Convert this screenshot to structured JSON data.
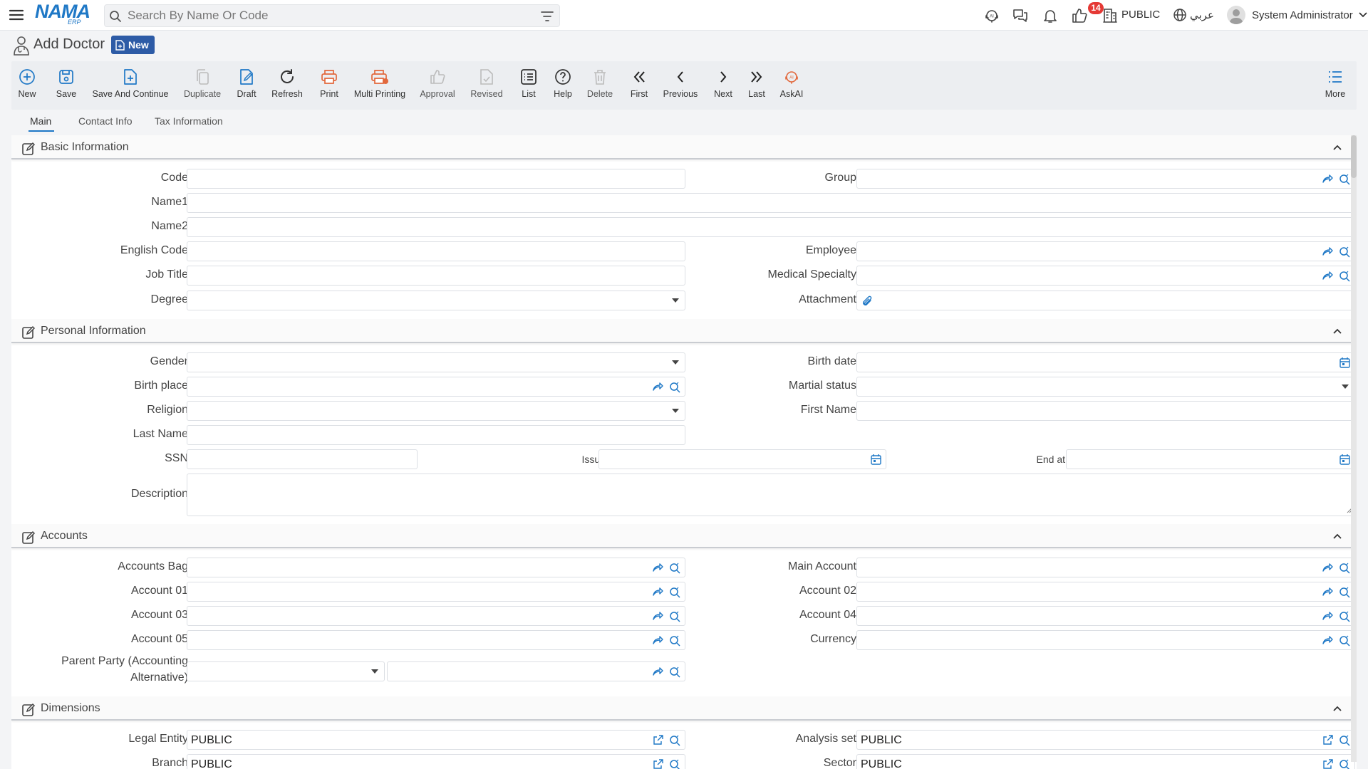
{
  "topbar": {
    "search_placeholder": "Search By Name Or Code",
    "notification_count": "14",
    "company": "PUBLIC",
    "language": "عربي",
    "user": "System Administrator",
    "logo_main": "NAMA",
    "logo_sub": "ERP"
  },
  "page": {
    "title": "Add Doctor",
    "status_badge": "New"
  },
  "toolbar": {
    "new": "New",
    "save": "Save",
    "save_continue": "Save And Continue",
    "duplicate": "Duplicate",
    "draft": "Draft",
    "refresh": "Refresh",
    "print": "Print",
    "multi_printing": "Multi Printing",
    "approval": "Approval",
    "revised": "Revised",
    "list": "List",
    "help": "Help",
    "delete": "Delete",
    "first": "First",
    "previous": "Previous",
    "next": "Next",
    "last": "Last",
    "askai": "AskAI",
    "more": "More"
  },
  "tabs": {
    "main": "Main",
    "contact": "Contact Info",
    "tax": "Tax Information"
  },
  "sections": {
    "basic": "Basic Information",
    "personal": "Personal Information",
    "accounts": "Accounts",
    "dimensions": "Dimensions"
  },
  "labels": {
    "code": "Code",
    "group": "Group",
    "name1": "Name1",
    "name2": "Name2",
    "english_code": "English Code",
    "employee": "Employee",
    "job_title": "Job Title",
    "medical_specialty": "Medical Specialty",
    "degree": "Degree",
    "attachment": "Attachment",
    "gender": "Gender",
    "birth_date": "Birth date",
    "birth_place": "Birth place",
    "martial_status": "Martial status",
    "religion": "Religion",
    "first_name": "First Name",
    "last_name": "Last Name",
    "ssn": "SSN",
    "issue": "Issue",
    "end_at": "End at",
    "description": "Description",
    "accounts_bag": "Accounts Bag",
    "main_account": "Main Account",
    "account_01": "Account 01",
    "account_02": "Account 02",
    "account_03": "Account 03",
    "account_04": "Account 04",
    "account_05": "Account 05",
    "currency": "Currency",
    "parent_party_1": "Parent Party (Accounting",
    "parent_party_2": "Alternative)",
    "legal_entity": "Legal Entity",
    "analysis_set": "Analysis set",
    "branch": "Branch",
    "sector": "Sector"
  },
  "values": {
    "legal_entity": "PUBLIC",
    "analysis_set": "PUBLIC",
    "branch": "PUBLIC",
    "sector": "PUBLIC"
  },
  "colors": {
    "brand": "#1f78c6",
    "badge_bg": "#2d5ba6",
    "notification": "#e53935",
    "print_icon": "#e2683c"
  }
}
